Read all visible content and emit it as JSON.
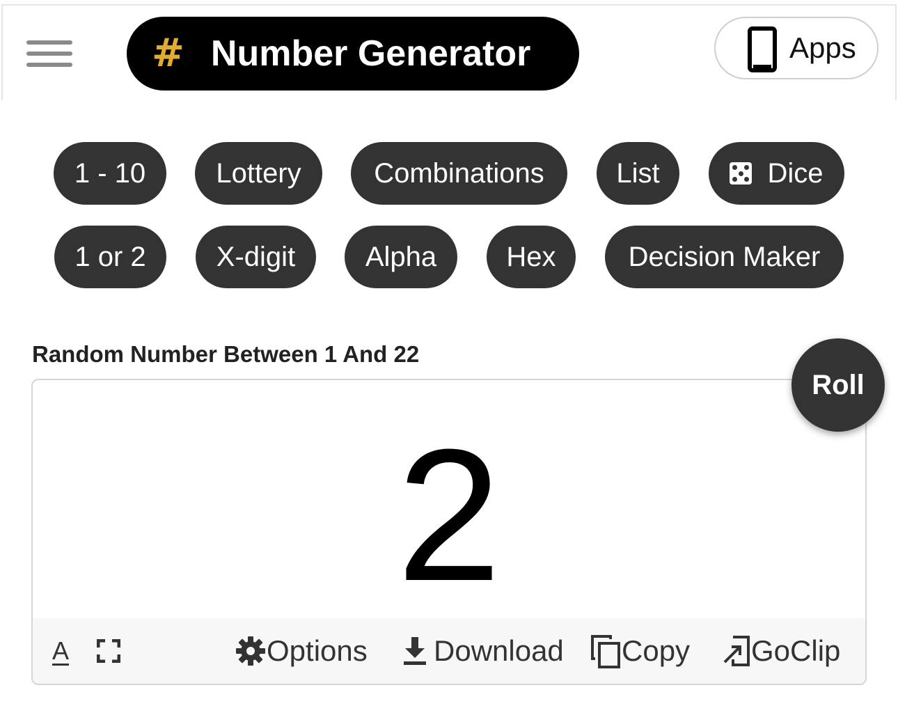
{
  "header": {
    "brand_icon": "#",
    "brand_title": "Number Generator",
    "apps_label": "Apps",
    "brand_icon_color": "#e0ad30"
  },
  "nav": {
    "row1": [
      {
        "label": "1 - 10"
      },
      {
        "label": "Lottery"
      },
      {
        "label": "Combinations"
      },
      {
        "label": "List"
      },
      {
        "label": "Dice",
        "icon": "dice-icon"
      }
    ],
    "row2": [
      {
        "label": "1 or 2"
      },
      {
        "label": "X-digit"
      },
      {
        "label": "Alpha"
      },
      {
        "label": "Hex"
      },
      {
        "label": "Decision Maker"
      }
    ]
  },
  "main": {
    "title": "Random Number Between 1 And 22",
    "result": "2",
    "roll_label": "Roll",
    "font_size_icon": "A",
    "toolbar": {
      "options": "Options",
      "download": "Download",
      "copy": "Copy",
      "goclip": "GoClip"
    }
  },
  "colors": {
    "pill_bg": "#333333",
    "header_bg": "#000000"
  }
}
